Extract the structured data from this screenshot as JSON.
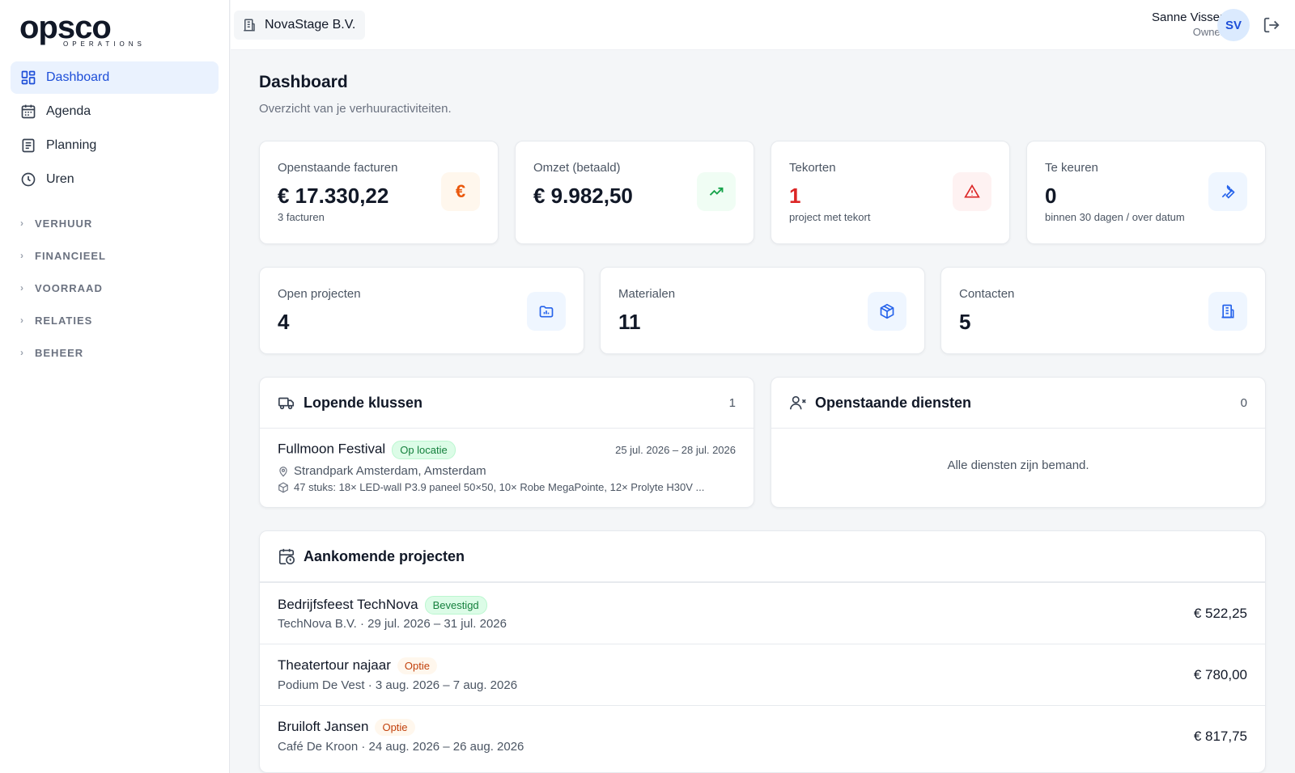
{
  "brand": {
    "logo_main": "opsco",
    "logo_sub": "OPERATIONS",
    "accent": "#1d4ed8"
  },
  "sidebar": {
    "items": [
      {
        "label": "Dashboard",
        "icon": "dashboard-grid-icon",
        "active": true
      },
      {
        "label": "Agenda",
        "icon": "calendar-icon"
      },
      {
        "label": "Planning",
        "icon": "clipboard-list-icon"
      },
      {
        "label": "Uren",
        "icon": "clock-icon"
      }
    ],
    "groups": [
      "VERHUUR",
      "FINANCIEEL",
      "VOORRAAD",
      "RELATIES",
      "BEHEER"
    ]
  },
  "topbar": {
    "org": "NovaStage B.V.",
    "user_name": "Sanne Visser",
    "user_role": "Owner",
    "avatar_initials": "SV"
  },
  "page": {
    "title": "Dashboard",
    "subtitle": "Overzicht van je verhuuractiviteiten."
  },
  "stats_row1": [
    {
      "label": "Openstaande facturen",
      "value": "€ 17.330,22",
      "sub": "3 facturen",
      "icon": "euro-icon",
      "color": "#ea580c"
    },
    {
      "label": "Omzet (betaald)",
      "value": "€ 9.982,50",
      "sub": "",
      "icon": "trending-up-icon",
      "color": "#16a34a"
    },
    {
      "label": "Tekorten",
      "value": "1",
      "sub": "project met tekort",
      "icon": "warning-icon",
      "color": "#dc2626"
    },
    {
      "label": "Te keuren",
      "value": "0",
      "sub": "binnen 30 dagen / over datum",
      "icon": "wrench-icon",
      "color": "#2563eb"
    }
  ],
  "stats_row2": [
    {
      "label": "Open projecten",
      "value": "4",
      "icon": "folder-chart-icon"
    },
    {
      "label": "Materialen",
      "value": "11",
      "icon": "package-icon"
    },
    {
      "label": "Contacten",
      "value": "5",
      "icon": "building-icon"
    }
  ],
  "lopende": {
    "title": "Lopende klussen",
    "count": "1",
    "job": {
      "title": "Fullmoon Festival",
      "status": "Op locatie",
      "dates": "25 jul. 2026 – 28 jul. 2026",
      "location": "Strandpark Amsterdam, Amsterdam",
      "items": "47 stuks: 18× LED-wall P3.9 paneel 50×50, 10× Robe MegaPointe, 12× Prolyte H30V ..."
    }
  },
  "diensten": {
    "title": "Openstaande diensten",
    "count": "0",
    "empty": "Alle diensten zijn bemand."
  },
  "aankomend": {
    "title": "Aankomende projecten",
    "projects": [
      {
        "title": "Bedrijfsfeest TechNova",
        "status": "Bevestigd",
        "status_type": "green",
        "sub": "TechNova B.V. · 29 jul. 2026 – 31 jul. 2026",
        "amount": "€ 522,25"
      },
      {
        "title": "Theatertour najaar",
        "status": "Optie",
        "status_type": "orange",
        "sub": "Podium De Vest · 3 aug. 2026 – 7 aug. 2026",
        "amount": "€ 780,00"
      },
      {
        "title": "Bruiloft Jansen",
        "status": "Optie",
        "status_type": "orange",
        "sub": "Café De Kroon · 24 aug. 2026 – 26 aug. 2026",
        "amount": "€ 817,75"
      }
    ]
  }
}
